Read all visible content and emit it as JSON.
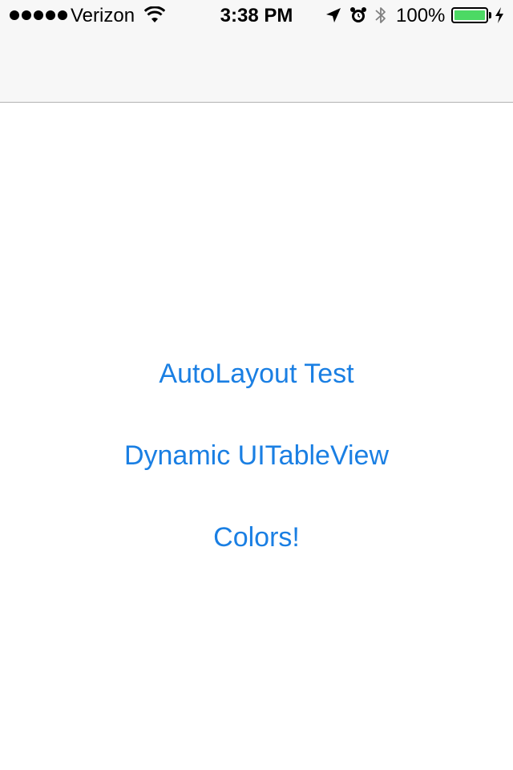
{
  "status_bar": {
    "carrier": "Verizon",
    "signal_bars": 5,
    "time": "3:38 PM",
    "battery_percent": "100%",
    "battery_level": 1.0,
    "battery_color": "#4cd964",
    "icons": [
      "wifi-icon",
      "location-arrow-icon",
      "alarm-clock-icon",
      "bluetooth-icon",
      "charging-bolt-icon"
    ]
  },
  "nav_bar": {
    "title": ""
  },
  "menu": {
    "accent_color": "#1a7fe3",
    "items": [
      {
        "label": "AutoLayout Test"
      },
      {
        "label": "Dynamic UITableView"
      },
      {
        "label": "Colors!"
      }
    ]
  }
}
